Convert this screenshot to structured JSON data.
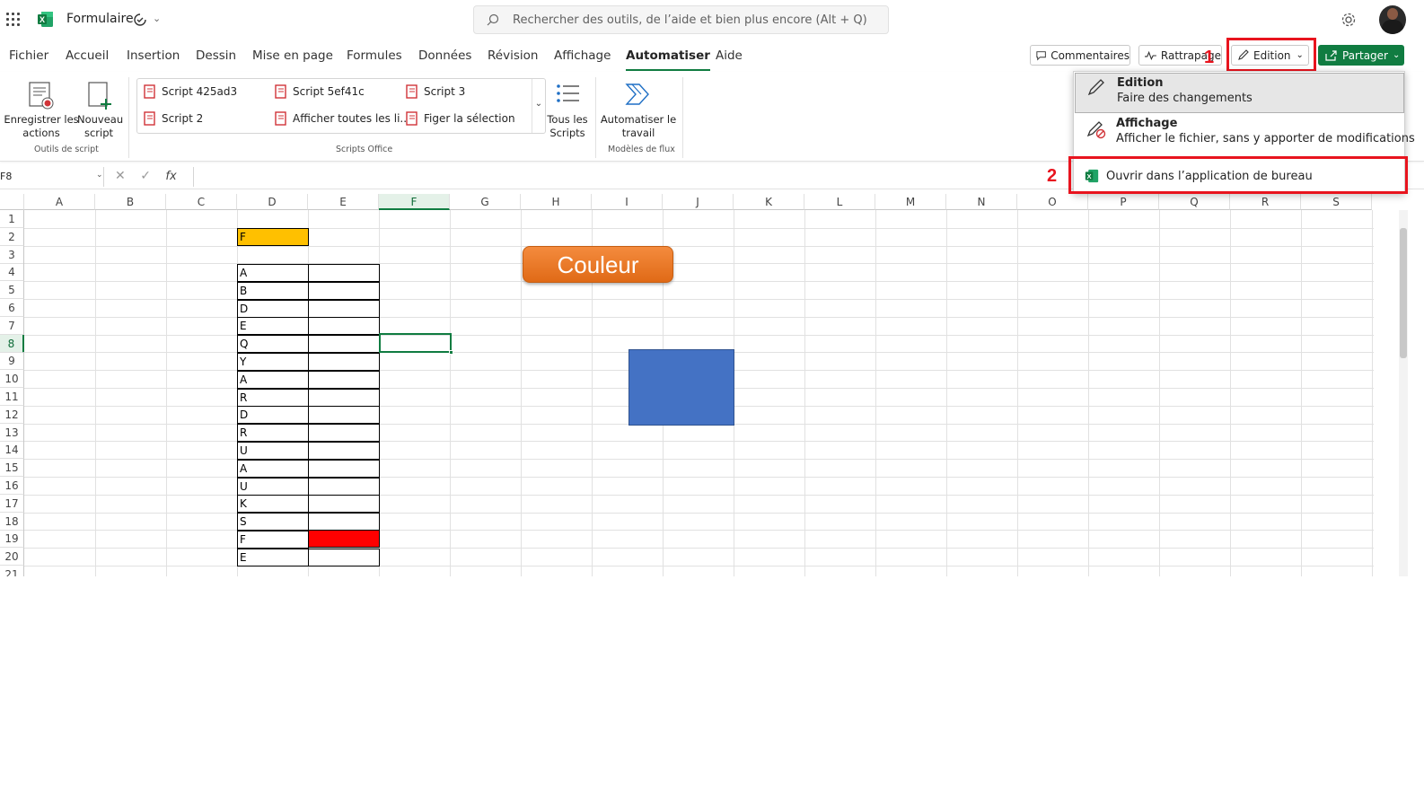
{
  "title": {
    "app_name": "Formulaire",
    "search_placeholder": "Rechercher des outils, de l’aide et bien plus encore (Alt + Q)"
  },
  "tabs": [
    "Fichier",
    "Accueil",
    "Insertion",
    "Dessin",
    "Mise en page",
    "Formules",
    "Données",
    "Révision",
    "Affichage",
    "Automatiser",
    "Aide"
  ],
  "active_tab": "Automatiser",
  "header_buttons": {
    "comments": "Commentaires",
    "catchup": "Rattrapage",
    "edition": "Edition",
    "share": "Partager"
  },
  "annotations": {
    "n1": "1",
    "n2": "2"
  },
  "ribbon": {
    "record_actions": "Enregistrer les actions",
    "record_actions_l1": "Enregistrer les",
    "record_actions_l2": "actions",
    "new_script_l1": "Nouveau",
    "new_script_l2": "script",
    "group_script_tools": "Outils de script",
    "scripts": [
      "Script 425ad3",
      "Script 5ef41c",
      "Script 3",
      "Script 2",
      "Afficher toutes les li...",
      "Figer la sélection"
    ],
    "group_office_scripts": "Scripts Office",
    "all_scripts_l1": "Tous les",
    "all_scripts_l2": "Scripts",
    "automate_l1": "Automatiser le",
    "automate_l2": "travail",
    "group_flow_templates": "Modèles de flux"
  },
  "formula_bar": {
    "name_box": "F8",
    "fx": "fx",
    "value": ""
  },
  "mode_menu": {
    "edition_title": "Edition",
    "edition_desc": "Faire des changements",
    "view_title": "Affichage",
    "view_desc": "Afficher le fichier, sans y apporter de modifications",
    "open_desktop": "Ouvrir dans l’application de bureau"
  },
  "sheet": {
    "columns": [
      "A",
      "B",
      "C",
      "D",
      "E",
      "F",
      "G",
      "H",
      "I",
      "J",
      "K",
      "L",
      "M",
      "N",
      "O",
      "P",
      "Q",
      "R",
      "S"
    ],
    "rows": [
      "1",
      "2",
      "3",
      "4",
      "5",
      "6",
      "7",
      "8",
      "9",
      "10",
      "11",
      "12",
      "13",
      "14",
      "15",
      "16",
      "17",
      "18",
      "19",
      "20",
      "21"
    ],
    "selected_cell": "F8",
    "d2": "F",
    "d_values": [
      "A",
      "B",
      "D",
      "E",
      "Q",
      "Y",
      "A",
      "R",
      "D",
      "R",
      "U",
      "A",
      "U",
      "K",
      "S",
      "F",
      "E"
    ],
    "shape_button_label": "Couleur",
    "colors": {
      "orange_cell": "#ffc000",
      "red_cell": "#ff0000",
      "blue_shape": "#4472c4",
      "accent": "#107c41"
    }
  }
}
